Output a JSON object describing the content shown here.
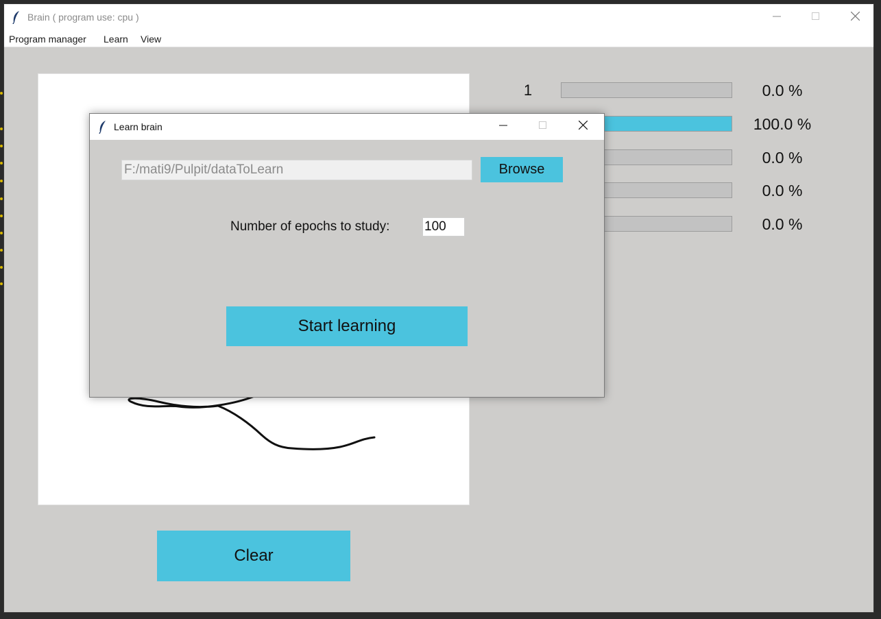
{
  "main_window": {
    "title": "Brain   ( program use: cpu )",
    "menu": [
      "Program manager",
      "Learn",
      "View"
    ]
  },
  "predictions": [
    {
      "label": "1",
      "value": 0.0,
      "percent_text": "0.0 %"
    },
    {
      "label": "",
      "value": 100.0,
      "percent_text": "100.0 %"
    },
    {
      "label": "",
      "value": 0.0,
      "percent_text": "0.0 %"
    },
    {
      "label": "",
      "value": 0.0,
      "percent_text": "0.0 %"
    },
    {
      "label": "",
      "value": 0.0,
      "percent_text": "0.0 %"
    }
  ],
  "clear_button": "Clear",
  "dialog": {
    "title": "Learn brain",
    "path_value": "F:/mati9/Pulpit/dataToLearn",
    "browse_label": "Browse",
    "epochs_label": "Number of epochs to study:",
    "epochs_value": "100",
    "start_label": "Start learning"
  },
  "colors": {
    "accent": "#4bc3de",
    "background": "#cecdcb",
    "bar_track": "#c2c2c2"
  },
  "icons": {
    "app": "feather-icon",
    "minimize": "minimize-icon",
    "maximize": "maximize-icon",
    "close": "close-icon"
  }
}
